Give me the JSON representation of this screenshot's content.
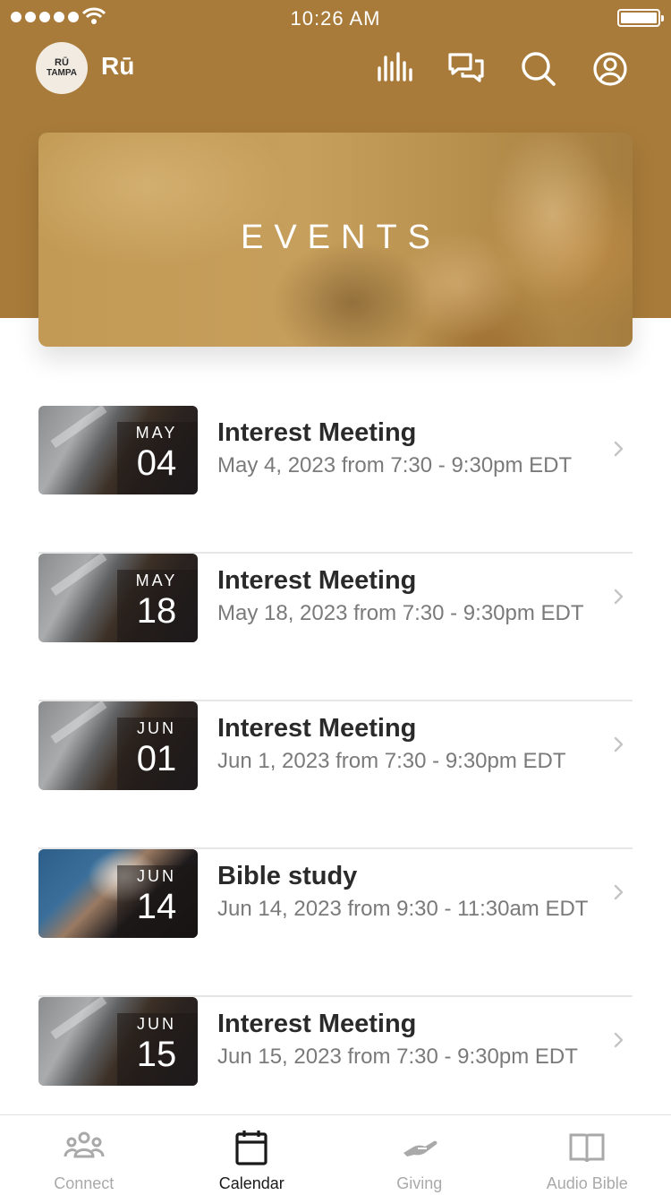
{
  "status_bar": {
    "time": "10:26 AM"
  },
  "header": {
    "logo_line1": "RŪ",
    "logo_line2": "TAMPA",
    "app_name": "Rū",
    "icons": [
      "equalizer-icon",
      "chat-icon",
      "search-icon",
      "profile-icon"
    ]
  },
  "hero": {
    "title": "EVENTS"
  },
  "events": [
    {
      "month": "MAY",
      "day": "04",
      "title": "Interest Meeting",
      "subtitle": "May 4, 2023 from 7:30 - 9:30pm EDT",
      "thumb": "meeting"
    },
    {
      "month": "MAY",
      "day": "18",
      "title": "Interest Meeting",
      "subtitle": "May 18, 2023 from 7:30 - 9:30pm EDT",
      "thumb": "meeting"
    },
    {
      "month": "JUN",
      "day": "01",
      "title": "Interest Meeting",
      "subtitle": "Jun 1, 2023 from 7:30 - 9:30pm EDT",
      "thumb": "meeting"
    },
    {
      "month": "JUN",
      "day": "14",
      "title": "Bible study",
      "subtitle": "Jun 14, 2023 from 9:30 - 11:30am EDT",
      "thumb": "bible"
    },
    {
      "month": "JUN",
      "day": "15",
      "title": "Interest Meeting",
      "subtitle": "Jun 15, 2023 from 7:30 - 9:30pm EDT",
      "thumb": "meeting"
    }
  ],
  "tabs": [
    {
      "label": "Connect",
      "icon": "people-icon"
    },
    {
      "label": "Calendar",
      "icon": "calendar-icon"
    },
    {
      "label": "Giving",
      "icon": "hand-icon"
    },
    {
      "label": "Audio Bible",
      "icon": "book-icon"
    }
  ],
  "colors": {
    "header_bg": "#a87b3a",
    "active_tab": "#1a1a1a",
    "inactive_tab": "#a9a9a9"
  }
}
